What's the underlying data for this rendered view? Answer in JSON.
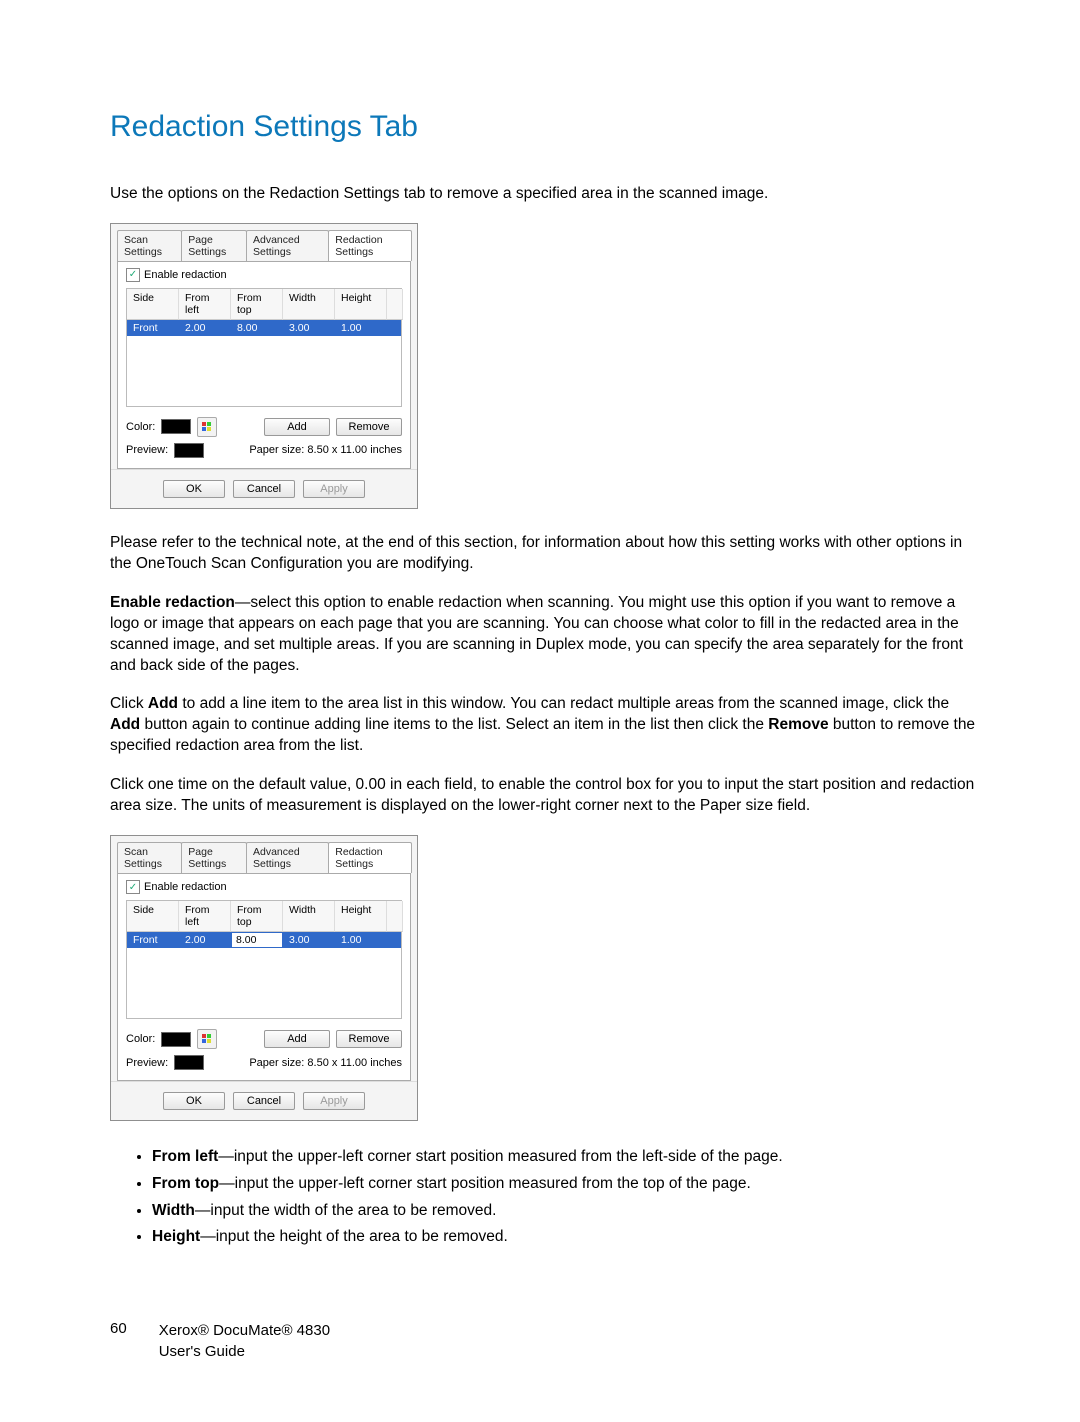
{
  "heading": "Redaction Settings Tab",
  "intro": "Use the options on the Redaction Settings tab to remove a specified area in the scanned image.",
  "para2": "Please refer to the technical note, at the end of this section, for information about how this setting works with other options in the OneTouch Scan Configuration you are modifying.",
  "enable_label": "Enable redaction",
  "enable_desc": "—select this option to enable redaction when scanning. You might use this option if you want to remove a logo or image that appears on each page that you are scanning. You can choose what color to fill in the redacted area in the scanned image, and set multiple areas. If you are scanning in Duplex mode, you can specify the area separately for the front and back side of the pages.",
  "para_add_pre": "Click ",
  "add_word": "Add",
  "para_add_mid": " to add a line item to the area list in this window. You can redact multiple areas from the scanned image, click the ",
  "para_add_mid2": " button again to continue adding line items to the list. Select an item in the list then click the ",
  "remove_word": "Remove",
  "para_add_end": " button to remove the specified redaction area from the list.",
  "para_click": "Click one time on the default value, 0.00 in each field, to enable the control box for you to input the start position and redaction area size. The units of measurement is displayed on the lower-right corner next to the Paper size field.",
  "bullets": {
    "from_left_l": "From left",
    "from_left_t": "—input the upper-left corner start position measured from the left-side of the page.",
    "from_top_l": "From top",
    "from_top_t": "—input the upper-left corner start position measured from the top of the page.",
    "width_l": "Width",
    "width_t": "—input the width of the area to be removed.",
    "height_l": "Height",
    "height_t": "—input the height of the area to be removed."
  },
  "footer": {
    "page": "60",
    "line1": "Xerox® DocuMate® 4830",
    "line2": "User's Guide"
  },
  "dialog": {
    "tabs": [
      "Scan Settings",
      "Page Settings",
      "Advanced Settings",
      "Redaction Settings"
    ],
    "checkbox": "Enable redaction",
    "headers": [
      "Side",
      "From left",
      "From top",
      "Width",
      "Height"
    ],
    "row": [
      "Front",
      "2.00",
      "8.00",
      "3.00",
      "1.00"
    ],
    "color_label": "Color:",
    "add": "Add",
    "remove": "Remove",
    "preview_label": "Preview:",
    "paper_size": "Paper size:  8.50 x 11.00 inches",
    "ok": "OK",
    "cancel": "Cancel",
    "apply": "Apply"
  }
}
